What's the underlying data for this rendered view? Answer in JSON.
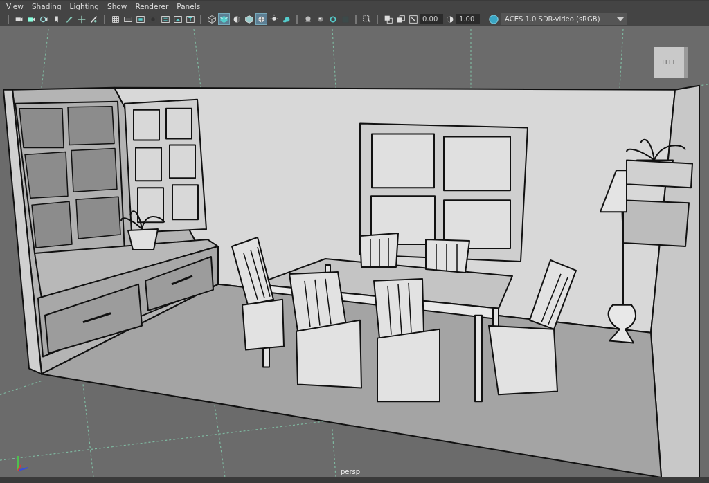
{
  "menu": [
    "View",
    "Shading",
    "Lighting",
    "Show",
    "Renderer",
    "Panels"
  ],
  "toolbar": {
    "groups": [
      {
        "buttons": [
          {
            "selected": false
          },
          {
            "selected": false
          },
          {
            "selected": false
          },
          {
            "selected": false
          },
          {
            "selected": false
          },
          {
            "selected": false
          },
          {
            "selected": false
          }
        ]
      },
      {
        "buttons": [
          {
            "selected": false
          },
          {
            "selected": false
          },
          {
            "selected": false
          },
          {
            "selected": false
          },
          {
            "selected": false
          },
          {
            "selected": false
          },
          {
            "selected": false
          }
        ]
      },
      {
        "buttons": [
          {
            "selected": false
          },
          {
            "selected": true
          },
          {
            "selected": false
          },
          {
            "selected": false
          },
          {
            "selected": true
          },
          {
            "selected": false
          },
          {
            "selected": false
          }
        ]
      },
      {
        "buttons": [
          {
            "selected": false
          },
          {
            "selected": false
          },
          {
            "selected": false
          },
          {
            "selected": false
          }
        ]
      },
      {
        "buttons": [
          {
            "selected": false
          }
        ]
      },
      {
        "buttons": [
          {
            "selected": false
          },
          {
            "selected": false
          },
          {
            "selected": false
          }
        ]
      }
    ],
    "exposure": "0.00",
    "gamma": "1.00",
    "color_space": "ACES 1.0 SDR-video (sRGB)"
  },
  "view_cube": {
    "label": "LEFT"
  },
  "camera_label": "persp"
}
